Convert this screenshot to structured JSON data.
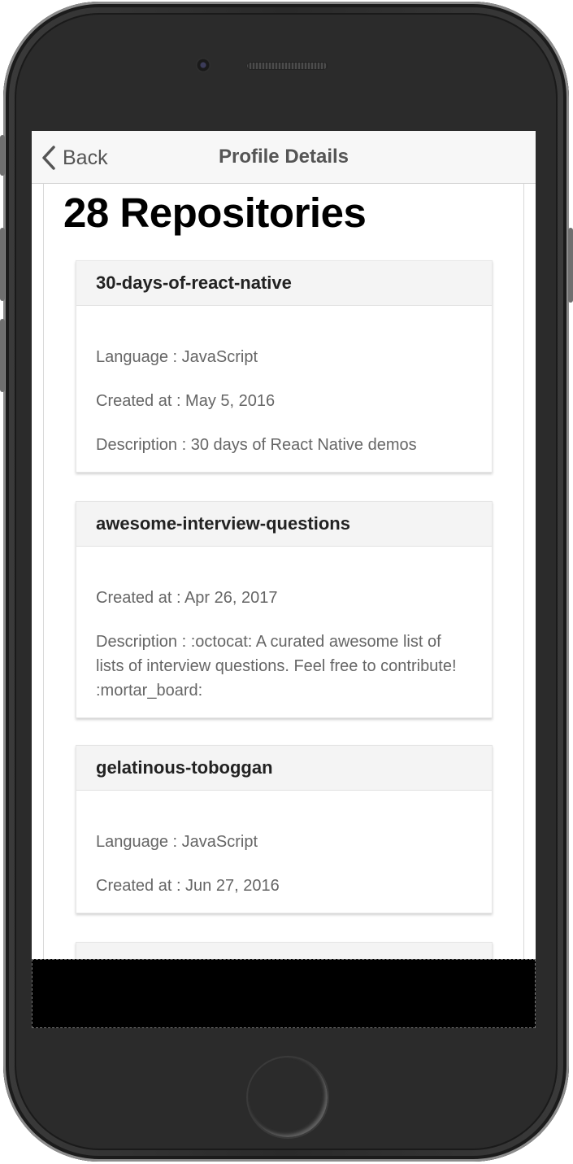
{
  "nav": {
    "back_label": "Back",
    "title": "Profile Details"
  },
  "heading": "28 Repositories",
  "repos": [
    {
      "name": "30-days-of-react-native",
      "language": "Language : JavaScript",
      "created": "Created at : May 5, 2016",
      "description": "Description : 30 days of React Native demos"
    },
    {
      "name": "awesome-interview-questions",
      "created": "Created at : Apr 26, 2017",
      "description": "Description : :octocat: A curated awesome list of lists of interview questions. Feel free to contribute! :mortar_board:"
    },
    {
      "name": "gelatinous-toboggan",
      "language": "Language : JavaScript",
      "created": "Created at : Jun 27, 2016"
    }
  ],
  "icons": {
    "back": "chevron-left-icon"
  }
}
